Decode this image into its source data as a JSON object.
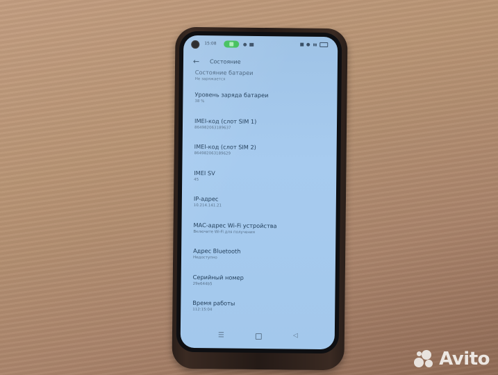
{
  "scene": {
    "description": "Smartphone in dark case on wooden surface showing device status settings screen",
    "colors": {
      "screen_background": "#a3c8ec",
      "text_primary": "#24405c",
      "text_secondary": "#58718a",
      "status_pill": "#3fbf5a",
      "phone_case": "#2a1f1a",
      "surface": "#b89474"
    }
  },
  "status_bar": {
    "time": "15:08",
    "icons": [
      "camera-hole",
      "notification-pill",
      "status-icon",
      "status-icon",
      "sim-icon",
      "wifi-icon",
      "signal-icon",
      "battery-icon"
    ]
  },
  "app_bar": {
    "back_icon": "←",
    "title": "Состояние"
  },
  "items": [
    {
      "label": "Состояние батареи",
      "value": "Не заряжается"
    },
    {
      "label": "Уровень заряда батареи",
      "value": "38 %"
    },
    {
      "label": "IMEI-код (слот SIM 1)",
      "value": "864982063189637"
    },
    {
      "label": "IMEI-код (слот SIM 2)",
      "value": "864982063189629"
    },
    {
      "label": "IMEI SV",
      "value": "45"
    },
    {
      "label": "IP-адрес",
      "value": "10.214.141.21"
    },
    {
      "label": "MAC-адрес Wi-Fi устройства",
      "value": "Включите Wi-Fi для получения"
    },
    {
      "label": "Адрес Bluetooth",
      "value": "Недоступно"
    },
    {
      "label": "Серийный номер",
      "value": "29e644b5"
    },
    {
      "label": "Время работы",
      "value": "112:15:04"
    }
  ],
  "nav_bar": {
    "menu_icon": "☰",
    "back_icon": "◁"
  },
  "watermark": {
    "text": "Avito"
  }
}
